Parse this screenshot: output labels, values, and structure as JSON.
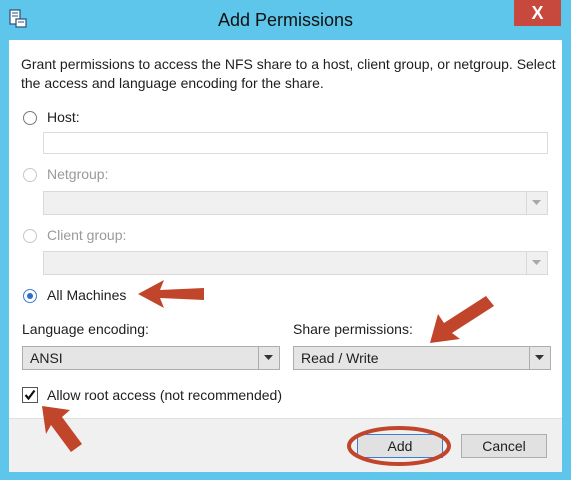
{
  "window": {
    "title": "Add Permissions",
    "close_glyph": "X",
    "app_icon": "server-share-icon"
  },
  "description": "Grant permissions to access the NFS share to a host, client group, or netgroup. Select the access and language encoding for the share.",
  "options": {
    "host": {
      "label": "Host:",
      "value": "",
      "enabled": true,
      "selected": false
    },
    "netgroup": {
      "label": "Netgroup:",
      "value": "",
      "enabled": false,
      "selected": false
    },
    "client_group": {
      "label": "Client group:",
      "value": "",
      "enabled": false,
      "selected": false
    },
    "all_machines": {
      "label": "All Machines",
      "enabled": true,
      "selected": true
    }
  },
  "language_encoding": {
    "label": "Language encoding:",
    "value": "ANSI"
  },
  "share_permissions": {
    "label": "Share permissions:",
    "value": "Read / Write"
  },
  "allow_root": {
    "label": "Allow root access (not recommended)",
    "checked": true
  },
  "buttons": {
    "add": "Add",
    "cancel": "Cancel"
  },
  "colors": {
    "title_bar": "#5ec6ea",
    "close_button": "#c7493e",
    "annotation": "#c0452a",
    "accent": "#3c7fd1"
  }
}
